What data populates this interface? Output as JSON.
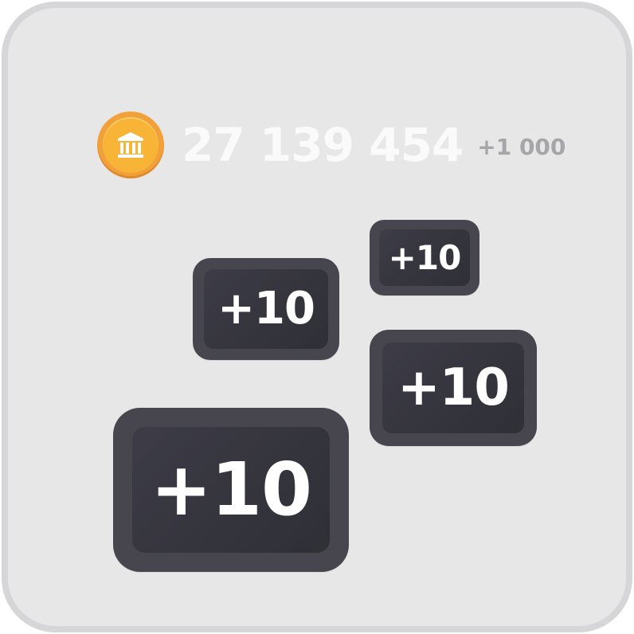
{
  "balance": {
    "icon": "bank-coin-icon",
    "amount": "27 139 454",
    "delta": "+1 000"
  },
  "rewards": [
    {
      "label": "+10"
    },
    {
      "label": "+10"
    },
    {
      "label": "+10"
    },
    {
      "label": "+10"
    }
  ],
  "colors": {
    "panel_background": "#e7e7e8",
    "panel_border": "#d6d6d8",
    "coin": "#f7b437",
    "amount_text": "#fafafa",
    "delta_text": "#a6a6aa",
    "bubble": "#3a3942",
    "bubble_text": "#ffffff"
  }
}
